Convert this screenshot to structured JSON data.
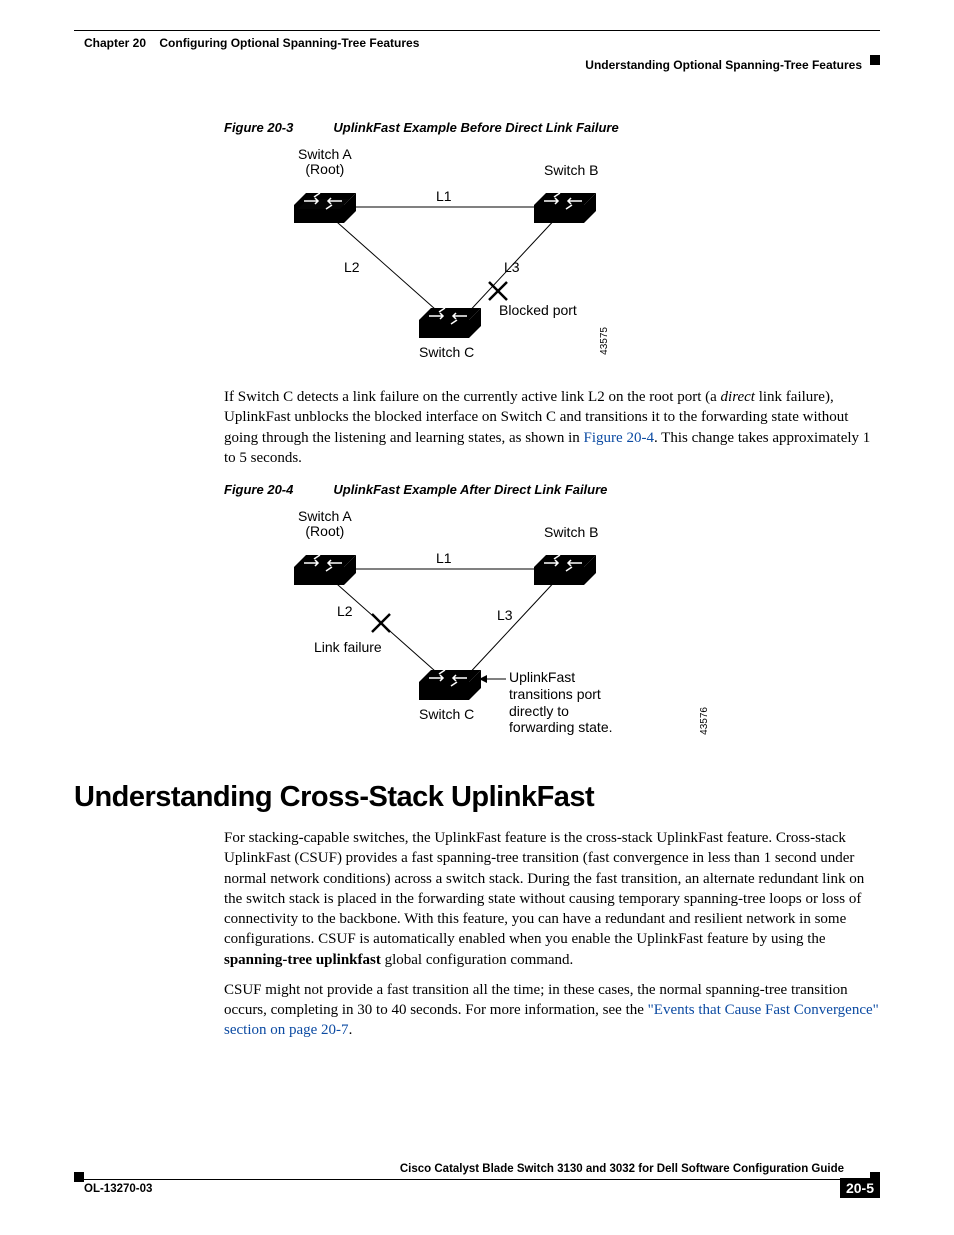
{
  "header": {
    "chapter": "Chapter 20",
    "chapter_title": "Configuring Optional Spanning-Tree Features",
    "subtitle": "Understanding Optional Spanning-Tree Features"
  },
  "fig3": {
    "caption_no": "Figure 20-3",
    "caption_title": "UplinkFast Example Before Direct Link Failure",
    "switchA": "Switch A",
    "root": "(Root)",
    "switchB": "Switch B",
    "switchC": "Switch C",
    "L1": "L1",
    "L2": "L2",
    "L3": "L3",
    "blocked": "Blocked port",
    "sideno": "43575"
  },
  "para1_a": "If Switch C detects a link failure on the currently active link L2 on the root port (a ",
  "para1_b": "direct",
  "para1_c": " link failure), UplinkFast unblocks the blocked interface on Switch C and transitions it to the forwarding state without going through the listening and learning states, as shown in ",
  "para1_link": "Figure 20-4",
  "para1_d": ". This change takes approximately 1 to 5 seconds.",
  "fig4": {
    "caption_no": "Figure 20-4",
    "caption_title": "UplinkFast Example After Direct Link Failure",
    "switchA": "Switch A",
    "root": "(Root)",
    "switchB": "Switch B",
    "switchC": "Switch C",
    "L1": "L1",
    "L2": "L2",
    "L3": "L3",
    "linkfail": "Link failure",
    "note1": "UplinkFast transitions port",
    "note2": "directly to forwarding state.",
    "sideno": "43576"
  },
  "section_title": "Understanding Cross-Stack UplinkFast",
  "para2_a": "For stacking-capable switches, the UplinkFast feature is the cross-stack UplinkFast feature. Cross-stack UplinkFast (CSUF) provides a fast spanning-tree transition (fast convergence in less than 1 second under normal network conditions) across a switch stack. During the fast transition, an alternate redundant link on the switch stack is placed in the forwarding state without causing temporary spanning-tree loops or loss of connectivity to the backbone. With this feature, you can have a redundant and resilient network in some configurations. CSUF is automatically enabled when you enable the UplinkFast feature by using the ",
  "para2_cmd": "spanning-tree uplinkfast",
  "para2_b": " global configuration command.",
  "para3_a": "CSUF might not provide a fast transition all the time; in these cases, the normal spanning-tree transition occurs, completing in 30 to 40 seconds. For more information, see the ",
  "para3_link": "\"Events that Cause Fast Convergence\" section on page 20-7",
  "para3_b": ".",
  "footer": {
    "guide": "Cisco Catalyst Blade Switch 3130 and 3032 for Dell Software Configuration Guide",
    "docid": "OL-13270-03",
    "pageno": "20-5"
  }
}
